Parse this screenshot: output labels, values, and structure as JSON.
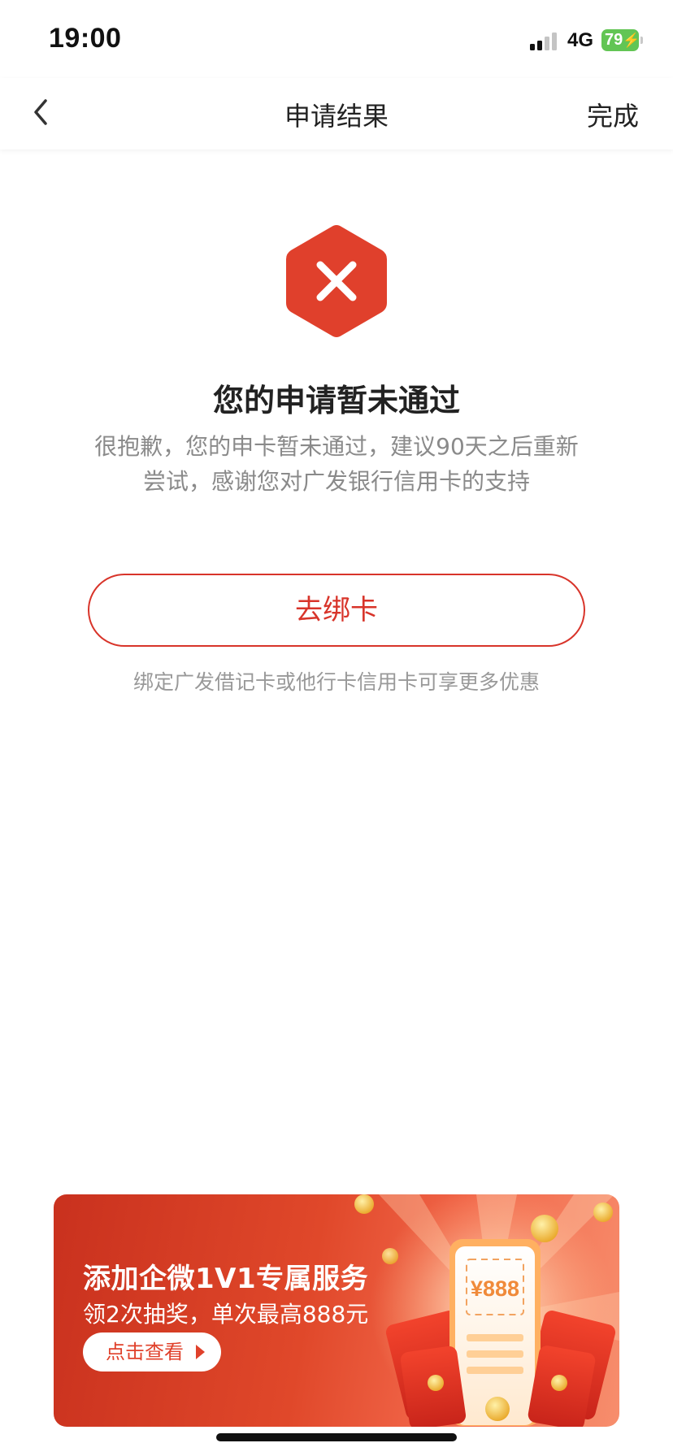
{
  "status_bar": {
    "time": "19:00",
    "network": "4G",
    "battery": "79"
  },
  "nav": {
    "title": "申请结果",
    "done_label": "完成"
  },
  "result": {
    "status": "failed",
    "title": "您的申请暂未通过",
    "description_line1": "很抱歉，您的申卡暂未通过，建议90天之后重新",
    "description_line2": "尝试，感谢您对广发银行信用卡的支持",
    "accent_color": "#e0402c"
  },
  "bind_card": {
    "button_label": "去绑卡",
    "hint": "绑定广发借记卡或他行卡信用卡可享更多优惠"
  },
  "banner": {
    "title": "添加企微1V1专属服务",
    "subtitle": "领2次抽奖，单次最高888元",
    "cta_label": "点击查看",
    "amount": "¥888"
  }
}
